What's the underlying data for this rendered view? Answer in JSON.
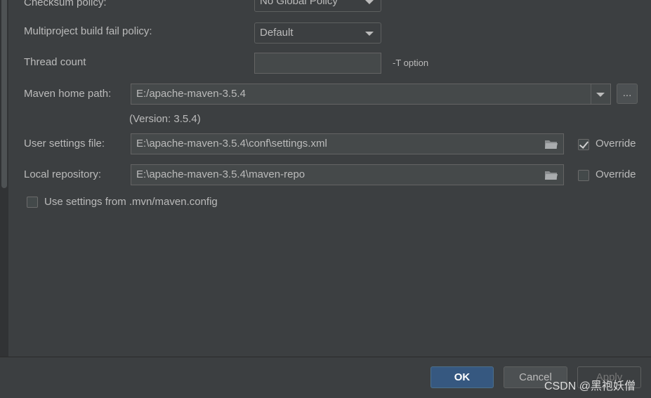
{
  "checksum": {
    "label": "Checksum policy:",
    "value": "No Global Policy"
  },
  "fail_policy": {
    "label": "Multiproject build fail policy:",
    "value": "Default"
  },
  "thread": {
    "label": "Thread count",
    "value": "",
    "hint": "-T option"
  },
  "maven_home": {
    "label": "Maven home path:",
    "value": "E:/apache-maven-3.5.4",
    "browse": "...",
    "version": "(Version: 3.5.4)"
  },
  "user_settings": {
    "label": "User settings file:",
    "value": "E:\\apache-maven-3.5.4\\conf\\settings.xml",
    "override_label": "Override",
    "override_checked": true
  },
  "local_repo": {
    "label": "Local repository:",
    "value": "E:\\apache-maven-3.5.4\\maven-repo",
    "override_label": "Override",
    "override_checked": false
  },
  "mvn_config": {
    "label": "Use settings from .mvn/maven.config",
    "checked": false
  },
  "buttons": {
    "ok": "OK",
    "cancel": "Cancel",
    "apply": "Apply"
  },
  "watermark": "CSDN @黑袍妖僧"
}
